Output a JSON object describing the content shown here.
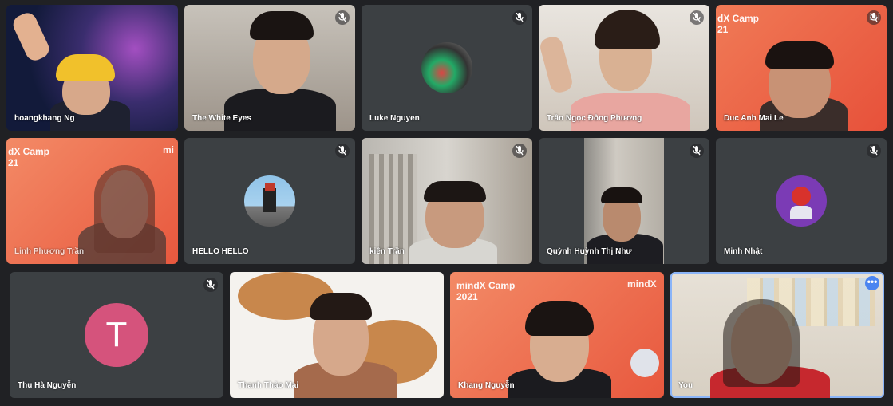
{
  "participants": [
    {
      "name": "hoangkhang Ng",
      "muted": false
    },
    {
      "name": "The White Eyes",
      "muted": true
    },
    {
      "name": "Luke Nguyen",
      "muted": true
    },
    {
      "name": "Trần Ngọc Đông Phương",
      "muted": true
    },
    {
      "name": "Duc Anh Mai Le",
      "muted": true
    },
    {
      "name": "Linh Phương Trần",
      "muted": false
    },
    {
      "name": "HELLO HELLO",
      "muted": true
    },
    {
      "name": "kiên Trần",
      "muted": true
    },
    {
      "name": "Quỳnh Huỳnh Thị Như",
      "muted": true
    },
    {
      "name": "Minh Nhật",
      "muted": true
    },
    {
      "name": "Thu Hà Nguyễn",
      "muted": true
    },
    {
      "name": "Thanh Thảo Mai",
      "muted": false
    },
    {
      "name": "Khang Nguyễn",
      "muted": false
    },
    {
      "name": "You",
      "muted": false
    }
  ],
  "initial_avatar": {
    "letter": "T",
    "color": "#d5537c"
  },
  "background": {
    "camp_line1": "mindX Camp",
    "camp_line1_partial": "dX Camp",
    "camp_line2": "2021",
    "camp_line2_partial": "21",
    "brand": "mindX",
    "brand_partial": "mi"
  },
  "colors": {
    "page_bg": "#202124",
    "tile_bg": "#3c4043",
    "active_border": "#8ab4f8",
    "camp_orange": "#ee6c4a"
  },
  "icons": {
    "mute": "mic-off-icon",
    "more": "more-options-icon"
  },
  "more_options_glyph": "•••"
}
